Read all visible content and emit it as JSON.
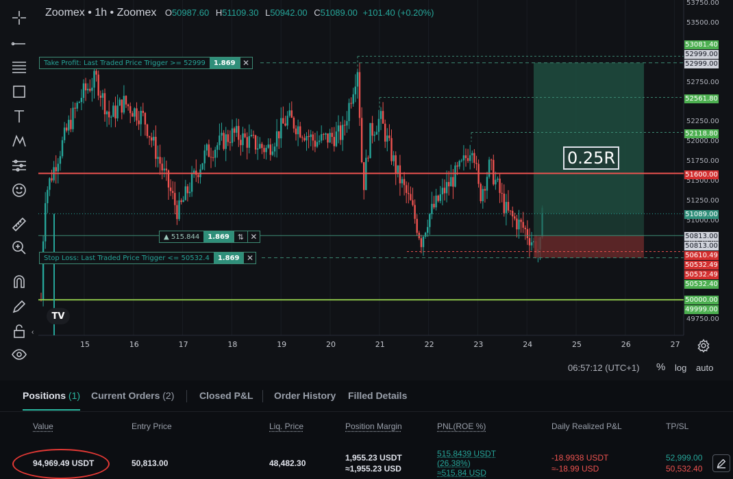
{
  "header": {
    "symbol": "Zoomex • 1h • Zoomex",
    "ohlc": {
      "o_label": "O",
      "o": "50987.60",
      "h_label": "H",
      "h": "51109.30",
      "l_label": "L",
      "l": "50942.00",
      "c_label": "C",
      "c": "51089.00"
    },
    "change": "+101.40 (+0.20%)"
  },
  "toolbar": {
    "icons": [
      "crosshair-icon",
      "line-tool-icon",
      "fib-tool-icon",
      "rectangle-tool-icon",
      "text-tool-icon",
      "pattern-tool-icon",
      "position-tool-icon",
      "emoji-icon",
      "ruler-icon",
      "zoom-in-icon",
      "magnet-icon",
      "pencil-icon",
      "lock-icon",
      "eye-icon"
    ]
  },
  "chart": {
    "price_axis_labels": [
      "53750.00",
      "53500.00",
      "52750.00",
      "52500.00",
      "52250.00",
      "52000.00",
      "51750.00",
      "51500.00",
      "51250.00",
      "51000.00",
      "50750.00",
      "49750.00"
    ],
    "price_tags": [
      {
        "v": "53081.40",
        "style": "lgreen"
      },
      {
        "v": "52999.00",
        "style": "gray"
      },
      {
        "v": "52999.00",
        "style": "gray"
      },
      {
        "v": "52561.80",
        "style": "lgreen"
      },
      {
        "v": "52118.80",
        "style": "lgreen"
      },
      {
        "v": "51600.00",
        "style": "red"
      },
      {
        "v": "51089.00",
        "style": "teal"
      },
      {
        "v": "50813.00",
        "style": "gray"
      },
      {
        "v": "50813.00",
        "style": "gray"
      },
      {
        "v": "50610.49",
        "style": "red"
      },
      {
        "v": "50532.49",
        "style": "red"
      },
      {
        "v": "50532.49",
        "style": "red"
      },
      {
        "v": "50532.40",
        "style": "lgreen"
      },
      {
        "v": "50000.00",
        "style": "lgreen"
      },
      {
        "v": "49999.00",
        "style": "lgreen"
      }
    ],
    "time_labels": [
      "15",
      "16",
      "17",
      "18",
      "19",
      "20",
      "21",
      "22",
      "23",
      "24",
      "25",
      "26",
      "27"
    ],
    "take_profit": {
      "label": "Take Profit: Last Traded Price Trigger >= 52999",
      "qty": "1.869"
    },
    "position_line": {
      "label": "▲ 515.844",
      "qty": "1.869",
      "arrows": "⇅"
    },
    "stop_loss": {
      "label": "Stop Loss: Last Traded Price Trigger <= 50532.4",
      "qty": "1.869"
    },
    "risk_reward": "0.25R",
    "logo": "TV",
    "close_glyph": "✕",
    "collapse_glyph": "‹",
    "colors": {
      "up": "#26a69a",
      "down": "#ef5350",
      "sl_line": "#ef5350",
      "green_line": "#8bc34a"
    }
  },
  "status": {
    "time": "06:57:12 (UTC+1)",
    "percent": "%",
    "log": "log",
    "auto": "auto"
  },
  "panel": {
    "tabs": [
      {
        "label": "Positions",
        "count": "(1)",
        "active": true
      },
      {
        "label": "Current Orders",
        "count": "(2)"
      },
      {
        "label": "Closed P&L"
      },
      {
        "label": "Order History"
      },
      {
        "label": "Filled Details"
      }
    ],
    "headers": {
      "value": "Value",
      "entry": "Entry Price",
      "liq": "Liq. Price",
      "margin": "Position Margin",
      "pnl": "PNL(ROE %)",
      "daily": "Daily Realized P&L",
      "tpsl": "TP/SL"
    },
    "row": {
      "value": "94,969.49  USDT",
      "entry": "50,813.00",
      "liq": "48,482.30",
      "margin_1": "1,955.23 USDT",
      "margin_2": "≈1,955.23 USD",
      "pnl_1": "515.8439 USDT",
      "pnl_2": "(26.38%)",
      "pnl_3": "≈515.84 USD",
      "daily_1": "-18.9938 USDT",
      "daily_2": "≈-18.99 USD",
      "tp": "52,999.00",
      "sl": "50,532.40"
    }
  }
}
